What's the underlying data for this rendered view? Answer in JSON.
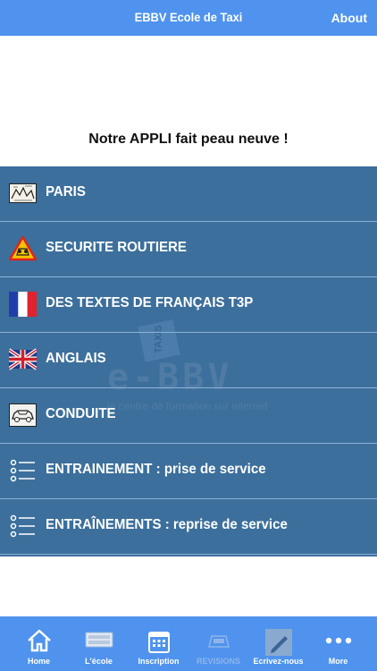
{
  "header": {
    "title": "EBBV Ecole de Taxi",
    "about_label": "About"
  },
  "notice": "Notre APPLI fait peau neuve !",
  "watermark": {
    "badge_text": "TAXIS",
    "logo_text": "e-BBV",
    "tagline": "le centre de formation sur internet"
  },
  "menu": {
    "items": [
      {
        "label": "PARIS",
        "icon": "paris-map-icon"
      },
      {
        "label": "SECURITE ROUTIERE",
        "icon": "warning-triangle-icon"
      },
      {
        "label": "DES TEXTES DE FRANÇAIS T3P",
        "icon": "french-flag-icon"
      },
      {
        "label": "ANGLAIS",
        "icon": "uk-flag-icon"
      },
      {
        "label": "CONDUITE",
        "icon": "car-icon"
      },
      {
        "label": "ENTRAINEMENT : prise de service",
        "icon": "list-icon"
      },
      {
        "label": "ENTRAÎNEMENTS : reprise de service",
        "icon": "list-icon"
      }
    ]
  },
  "tabs": [
    {
      "label": "Home",
      "icon": "home-icon"
    },
    {
      "label": "L'école",
      "icon": "school-sign-icon"
    },
    {
      "label": "Inscription",
      "icon": "calendar-icon"
    },
    {
      "label": "REVISIONS",
      "icon": "taxi-sign-icon"
    },
    {
      "label": "Ecrivez-nous",
      "icon": "pen-icon"
    },
    {
      "label": "More",
      "icon": "more-icon"
    }
  ],
  "colors": {
    "nav": "#4f93ee",
    "menu": "#3c6f9c",
    "divider": "#8bb3da"
  }
}
